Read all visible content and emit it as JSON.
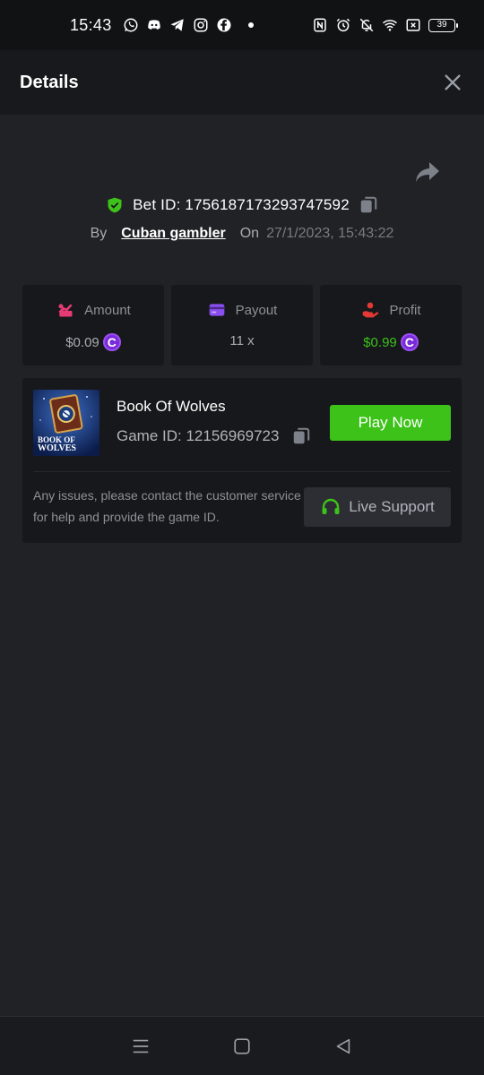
{
  "status_bar": {
    "time": "15:43",
    "battery": "39",
    "left_icons": [
      "whatsapp-icon",
      "discord-icon",
      "telegram-icon",
      "instagram-icon",
      "facebook-icon"
    ],
    "right_icons": [
      "nfc-icon",
      "alarm-icon",
      "mute-icon",
      "wifi-icon",
      "sim-x-icon",
      "battery-icon"
    ]
  },
  "header": {
    "title": "Details"
  },
  "bet": {
    "id_text": "Bet ID: 1756187173293747592",
    "by_label": "By",
    "username": "Cuban gambler",
    "on_label": "On",
    "date": "27/1/2023, 15:43:22"
  },
  "stats": {
    "amount": {
      "label": "Amount",
      "value": "$0.09",
      "icon": "amount-icon",
      "color": "#e53b74"
    },
    "payout": {
      "label": "Payout",
      "value": "11 x",
      "icon": "card-icon",
      "color": "#8a4ff0"
    },
    "profit": {
      "label": "Profit",
      "value": "$0.99",
      "icon": "hand-coin-icon",
      "color": "#e53935"
    }
  },
  "game": {
    "name": "Book Of Wolves",
    "id_text": "Game ID: 12156969723",
    "thumb_title": "BOOK OF WOLVES",
    "play_label": "Play Now"
  },
  "support": {
    "message": "Any issues, please contact the customer service for help and provide the game ID.",
    "button_label": "Live Support"
  },
  "colors": {
    "accent_green": "#3dc21a",
    "coin_purple": "#7a2bd9",
    "background": "#212226",
    "card": "#17181b"
  },
  "coin_symbol": "C"
}
